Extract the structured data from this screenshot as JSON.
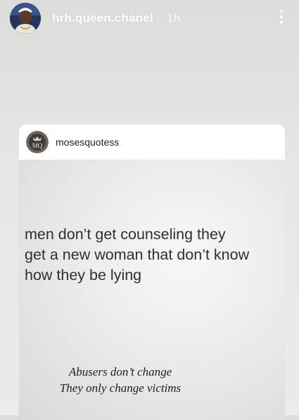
{
  "story": {
    "username": "hrh.queen.chanel",
    "time": "1h",
    "avatar_icon": "profile-avatar-icon",
    "more_icon": "more-vertical-icon"
  },
  "post": {
    "username": "mosesquotess",
    "avatar_icon": "quote-logo-icon",
    "quote_lines": [
      "men don’t get counseling they",
      "get a new woman that don’t know",
      "how they be lying"
    ],
    "sub_lines": [
      "Abusers don’t change",
      "They only change victims"
    ]
  },
  "colors": {
    "background": "#e6e6e3",
    "header_text": "#ffffff",
    "card_bg": "#ffffff",
    "quote_text": "#2f2f2f"
  }
}
